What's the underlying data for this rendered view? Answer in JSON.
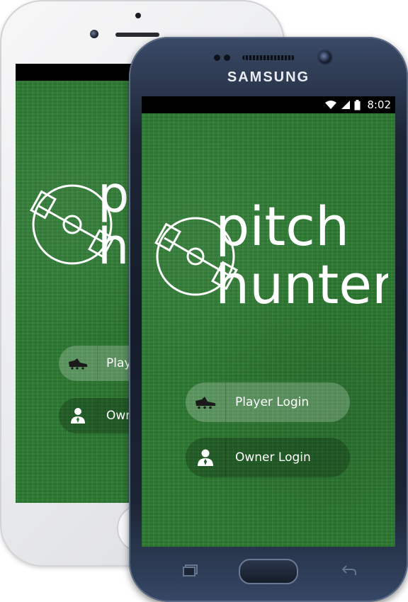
{
  "samsung": {
    "brand": "SAMSUNG",
    "status_bar": {
      "time": "8:02",
      "icons": [
        "wifi-icon",
        "signal-icon",
        "battery-icon"
      ]
    }
  },
  "app": {
    "logo": {
      "line1": "pitch",
      "line2": "hunter",
      "emblem": "football-pitch-icon"
    },
    "buttons": {
      "player": {
        "label": "Player Login",
        "icon": "football-boot-icon"
      },
      "owner": {
        "label": "Owner Login",
        "icon": "owner-person-icon"
      }
    }
  },
  "iphone": {
    "visible_text": {
      "player_partial": "Play",
      "owner_partial": "Own"
    }
  },
  "colors": {
    "grass": "#2d7a32",
    "samsung_body": "#1c2536",
    "iphone_body": "#eeeef0",
    "button_light": "rgba(255,255,255,0.22)",
    "button_dark": "rgba(0,0,0,0.22)"
  }
}
